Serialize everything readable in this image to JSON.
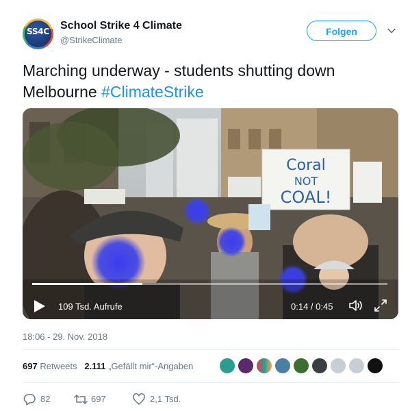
{
  "account": {
    "name": "School Strike 4 Climate",
    "handle": "@StrikeClimate",
    "avatar_text": "SS4C"
  },
  "follow_label": "Folgen",
  "tweet": {
    "text": "Marching underway - students shutting down Melbourne ",
    "hashtag": "#ClimateStrike"
  },
  "video": {
    "views": "109 Tsd. Aufrufe",
    "time": "0:14 / 0:45",
    "progress": 0.31,
    "sign_text": "Coral NOT COAL!"
  },
  "timestamp": "18:06 - 29. Nov. 2018",
  "stats": {
    "retweets_count": "697",
    "retweets_label": "Retweets",
    "likes_count": "2.111",
    "likes_label": "„Gefällt mir“-Angaben"
  },
  "actions": {
    "reply_count": "82",
    "retweet_count": "697",
    "like_count": "2,1 Tsd."
  },
  "colors": {
    "accent": "#1da1f2",
    "hashtag": "#1b95e0",
    "muted": "#657786"
  }
}
